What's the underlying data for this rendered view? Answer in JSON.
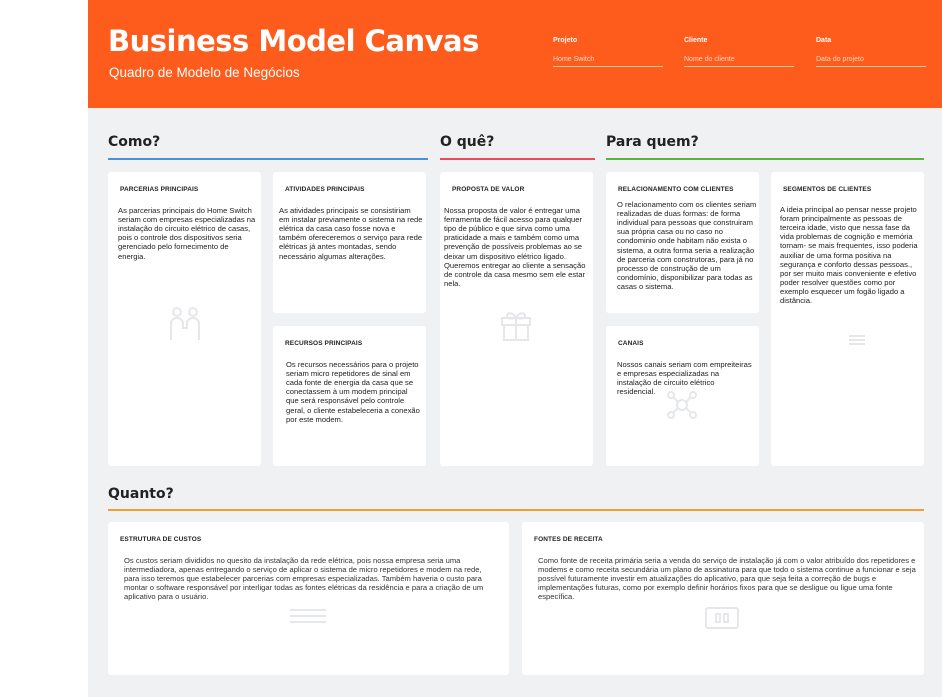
{
  "header": {
    "title": "Business Model Canvas",
    "subtitle": "Quadro de Modelo de Negócios",
    "fields": {
      "projeto": {
        "label": "Projeto",
        "value": "Home Switch"
      },
      "cliente": {
        "label": "Cliente",
        "value": "Nome do cliente"
      },
      "data": {
        "label": "Data",
        "value": "Data do projeto"
      }
    },
    "accent": "#fe5c1c"
  },
  "sections": {
    "como": {
      "title": "Como?",
      "color": "#4a90d9"
    },
    "oque": {
      "title": "O quê?",
      "color": "#e84c5a"
    },
    "paraquem": {
      "title": "Para quem?",
      "color": "#58b63e"
    },
    "quanto": {
      "title": "Quanto?",
      "color": "#f0a030"
    }
  },
  "cards": {
    "parcerias": {
      "title": "Parcerias principais",
      "body": "As parcerias principais do Home Switch seriam com empresas especializadas na instalação do circuito elétrico de casas, pois o controle dos dispositivos seria gerenciado pelo fornecimento de energia.",
      "icon": "partnership-icon"
    },
    "atividades": {
      "title": "Atividades principais",
      "body": "As atividades principais se consistiriam em instalar previamente o sistema na rede elétrica da casa caso fosse nova e também ofereceremos o serviço para rede elétricas já antes montadas, sendo necessário algumas alterações.",
      "icon": "checklist-icon"
    },
    "recursos": {
      "title": "Recursos principais",
      "body": "Os recursos necessários para o projeto seriam micro repetidores de sinal em cada fonte de energia da casa que se conectassem à um modem principal que será responsável pelo controle geral, o cliente estabeleceria a conexão por este modem.",
      "icon": "resources-icon"
    },
    "proposta": {
      "title": "Proposta de valor",
      "body": "Nossa proposta de valor é entregar uma ferramenta de fácil acesso para qualquer tipo de público e que sirva como uma praticidade a mais e também como uma prevenção de possíveis problemas ao se deixar um dispositivo elétrico ligado. Queremos entregar ao cliente a sensação de controle da casa mesmo sem ele estar nela.",
      "icon": "gift-icon"
    },
    "relacionamento": {
      "title": "Relacionamento com clientes",
      "body": "O relacionamento com os clientes seriam realizadas de duas formas: de forma individual para pessoas que construiram sua própria casa ou no caso no condominio onde habitam não exista o sistema, a outra forma seria a realização de parceria com construtoras, para já no processo de construção de um condomínio, disponibilizar para todas as casas o sistema.",
      "icon": "heart-icon"
    },
    "canais": {
      "title": "Canais",
      "body": "Nossos canais seriam com empreiteiras e empresas especializadas na instalação de circuito elétrico residencial.",
      "icon": "network-icon"
    },
    "segmentos": {
      "title": "Segmentos de clientes",
      "body": "A ideia principal ao pensar nesse projeto foram principalmente as pessoas de terceira idade, visto que nessa fase da vida problemas de cognição e memória tornam- se mais frequentes, isso poderia auxiliar de uma forma positiva na segurança e conforto dessas pessoas., por ser muito mais conveniente e efetivo poder resolver questões como por exemplo esquecer um fogão ligado a distância.",
      "icon": "people-icon"
    },
    "custos": {
      "title": "Estrutura de custos",
      "body": "Os custos seriam divididos no quesito da instalação da rede elétrica, pois nossa empresa seria uma intermediadora, apenas entregando o serviço de aplicar o sistema de micro repetidores e modem na rede, para isso teremos que estabelecer parcerias com empresas especializadas. Também haveria o custo para montar o software responsável por interligar todas as fontes elétricas da residência e para a criação de um aplicativo para o usuário.",
      "icon": "document-icon"
    },
    "receita": {
      "title": "Fontes de receita",
      "body": "Como fonte de receita primária seria a venda do serviço de instalação já com o valor atribuído dos repetidores e modems e como receita secundária um plano de assinatura para que todo o sistema continue a funcionar e seja possível futuramente investir em atualizações do aplicativo, para que seja feita a correção de bugs e implementações futuras, como por exemplo definir horários fixos para que se desligue ou ligue uma fonte específica.",
      "icon": "wallet-icon"
    }
  }
}
